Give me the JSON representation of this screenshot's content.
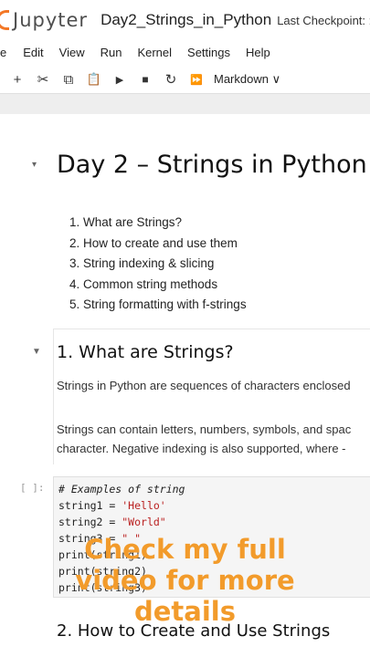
{
  "header": {
    "logo_text": "Jupyter",
    "notebook_title": "Day2_Strings_in_Python",
    "checkpoint": "Last Checkpoint: :"
  },
  "menu": [
    "e",
    "Edit",
    "View",
    "Run",
    "Kernel",
    "Settings",
    "Help"
  ],
  "toolbar": {
    "add": "+",
    "cut": "✂",
    "copy": "⧉",
    "paste": "📋",
    "run": "▶",
    "stop": "■",
    "restart": "↻",
    "run_all": "⏩",
    "cell_type": "Markdown ∨"
  },
  "notebook": {
    "title": "Day 2 – Strings in Python",
    "outline": [
      "1. What are Strings?",
      "2. How to create and use them",
      "3. String indexing & slicing",
      "4. Common string methods",
      "5. String formatting with f-strings"
    ],
    "section1": {
      "heading": "1. What are Strings?",
      "p1": "Strings in Python are sequences of characters enclosed",
      "p2a": "Strings can contain letters, numbers, symbols, and spac",
      "p2b": "character. Negative indexing is also supported, where -"
    },
    "code_cell": {
      "prompt": "[ ]:",
      "lines": [
        {
          "t": "# Examples of string",
          "cls": "cm"
        },
        {
          "pre": "string1 = ",
          "val": "'Hello'"
        },
        {
          "pre": "string2 = ",
          "val": "\"World\""
        },
        {
          "pre": "string3 = ",
          "val": "\" \""
        },
        {
          "pre": "print(string1)",
          "val": ""
        },
        {
          "pre": "print(string2)",
          "val": ""
        },
        {
          "pre": "print(string3)",
          "val": ""
        }
      ]
    },
    "section2_heading": "2. How to Create and Use Strings"
  },
  "overlay": {
    "line1": "Check my full",
    "line2": "video for more",
    "line3": "details"
  },
  "colors": {
    "accent": "#f37726",
    "overlay": "#f29b2b"
  }
}
